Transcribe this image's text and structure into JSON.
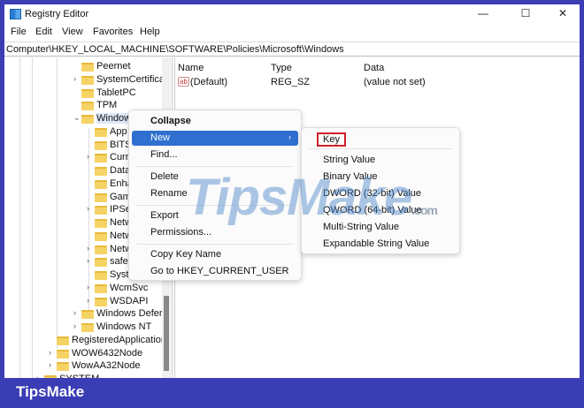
{
  "window": {
    "title": "Registry Editor",
    "minimize": "—",
    "maximize": "☐",
    "close": "✕"
  },
  "menu": [
    "File",
    "Edit",
    "View",
    "Favorites",
    "Help"
  ],
  "address": "Computer\\HKEY_LOCAL_MACHINE\\SOFTWARE\\Policies\\Microsoft\\Windows",
  "tree": [
    {
      "label": "Peernet",
      "level": 3,
      "chev": ""
    },
    {
      "label": "SystemCertifica",
      "level": 3,
      "chev": "›"
    },
    {
      "label": "TabletPC",
      "level": 3,
      "chev": ""
    },
    {
      "label": "TPM",
      "level": 3,
      "chev": ""
    },
    {
      "label": "Windows",
      "level": 3,
      "chev": "⌄",
      "selected": true
    },
    {
      "label": "App",
      "level": 4,
      "chev": ""
    },
    {
      "label": "BITS",
      "level": 4,
      "chev": ""
    },
    {
      "label": "Curr",
      "level": 4,
      "chev": "›"
    },
    {
      "label": "Data",
      "level": 4,
      "chev": ""
    },
    {
      "label": "Enha",
      "level": 4,
      "chev": ""
    },
    {
      "label": "Gam",
      "level": 4,
      "chev": ""
    },
    {
      "label": "IPSe",
      "level": 4,
      "chev": "›"
    },
    {
      "label": "Netw",
      "level": 4,
      "chev": ""
    },
    {
      "label": "Netw",
      "level": 4,
      "chev": ""
    },
    {
      "label": "Netw",
      "level": 4,
      "chev": "›"
    },
    {
      "label": "safe",
      "level": 4,
      "chev": "›"
    },
    {
      "label": "Syst",
      "level": 4,
      "chev": ""
    },
    {
      "label": "WcmSvc",
      "level": 4,
      "chev": "›"
    },
    {
      "label": "WSDAPI",
      "level": 4,
      "chev": "›"
    },
    {
      "label": "Windows Defer",
      "level": 3,
      "chev": "›"
    },
    {
      "label": "Windows NT",
      "level": 3,
      "chev": "›"
    },
    {
      "label": "RegisteredApplication",
      "level": 1,
      "chev": ""
    },
    {
      "label": "WOW6432Node",
      "level": 1,
      "chev": "›"
    },
    {
      "label": "WowAA32Node",
      "level": 1,
      "chev": "›"
    },
    {
      "label": "SYSTEM",
      "level": 0,
      "chev": "›"
    }
  ],
  "list": {
    "headers": [
      "Name",
      "Type",
      "Data"
    ],
    "rows": [
      {
        "icon": "ab",
        "name": "(Default)",
        "type": "REG_SZ",
        "data": "(value not set)"
      }
    ]
  },
  "context_menu": [
    "Collapse",
    "New",
    "Find...",
    "Delete",
    "Rename",
    "Export",
    "Permissions...",
    "Copy Key Name",
    "Go to HKEY_CURRENT_USER"
  ],
  "submenu": [
    "Key",
    "String Value",
    "Binary Value",
    "DWORD (32-bit) Value",
    "QWORD (64-bit) Value",
    "Multi-String Value",
    "Expandable String Value"
  ],
  "watermark": "TipsMake",
  "watermark_suffix": ".com",
  "brand": "TipsMake"
}
